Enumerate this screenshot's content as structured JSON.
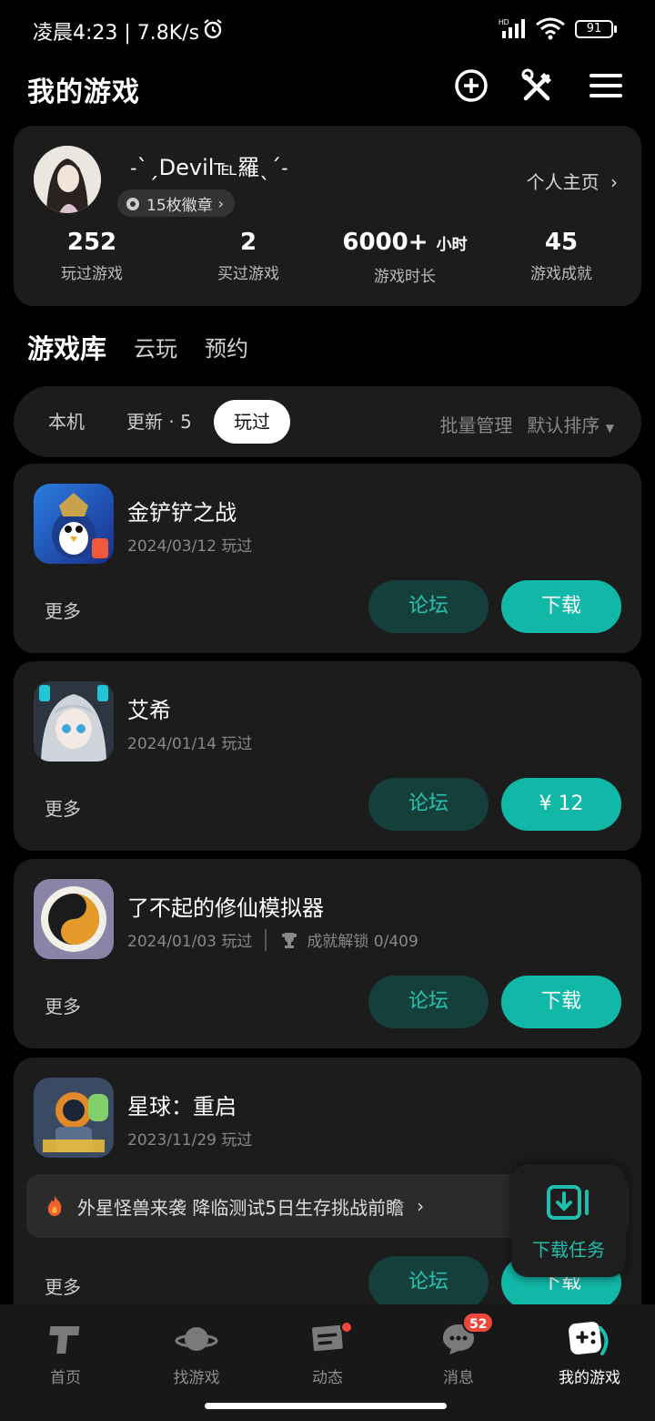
{
  "status_bar": {
    "time_text": "凌晨4:23 | 7.8K/s",
    "battery": "91"
  },
  "header": {
    "title": "我的游戏"
  },
  "profile": {
    "username": "˗ˋˏDevil℡羅ˎˊ˗",
    "badge_text": "15枚徽章",
    "homepage_link": "个人主页",
    "stats": [
      {
        "value": "252",
        "unit": "",
        "label": "玩过游戏"
      },
      {
        "value": "2",
        "unit": "",
        "label": "买过游戏"
      },
      {
        "value": "6000+",
        "unit": "小时",
        "label": "游戏时长"
      },
      {
        "value": "45",
        "unit": "",
        "label": "游戏成就"
      }
    ]
  },
  "tabs": {
    "main": "游戏库",
    "cloud": "云玩",
    "reserve": "预约"
  },
  "filter": {
    "chips": [
      "本机",
      "更新 · 5",
      "玩过"
    ],
    "active_chip": "玩过",
    "batch": "批量管理",
    "sort": "默认排序"
  },
  "games": [
    {
      "name": "金铲铲之战",
      "date": "2024/03/12 玩过",
      "more": "更多",
      "forum": "论坛",
      "action": "下载"
    },
    {
      "name": "艾希",
      "date": "2024/01/14 玩过",
      "more": "更多",
      "forum": "论坛",
      "action": "¥ 12"
    },
    {
      "name": "了不起的修仙模拟器",
      "date": "2024/01/03 玩过",
      "achievement": "成就解锁 0/409",
      "more": "更多",
      "forum": "论坛",
      "action": "下载"
    },
    {
      "name": "星球：重启",
      "date": "2023/11/29 玩过",
      "promo": "外星怪兽来袭 降临测试5日生存挑战前瞻",
      "more": "更多",
      "forum": "论坛",
      "action": "下载"
    }
  ],
  "float_button": {
    "label": "下载任务"
  },
  "bottom_nav": {
    "items": [
      {
        "label": "首页",
        "icon": "home-t-icon"
      },
      {
        "label": "找游戏",
        "icon": "planet-icon"
      },
      {
        "label": "动态",
        "icon": "feed-icon"
      },
      {
        "label": "消息",
        "icon": "chat-icon",
        "badge": "52"
      },
      {
        "label": "我的游戏",
        "icon": "gamepad-icon"
      }
    ]
  },
  "colors": {
    "accent": "#11b8a8",
    "forum_bg": "#153f3b",
    "card_bg": "#1c1c1c",
    "badge_red": "#f0473c"
  }
}
